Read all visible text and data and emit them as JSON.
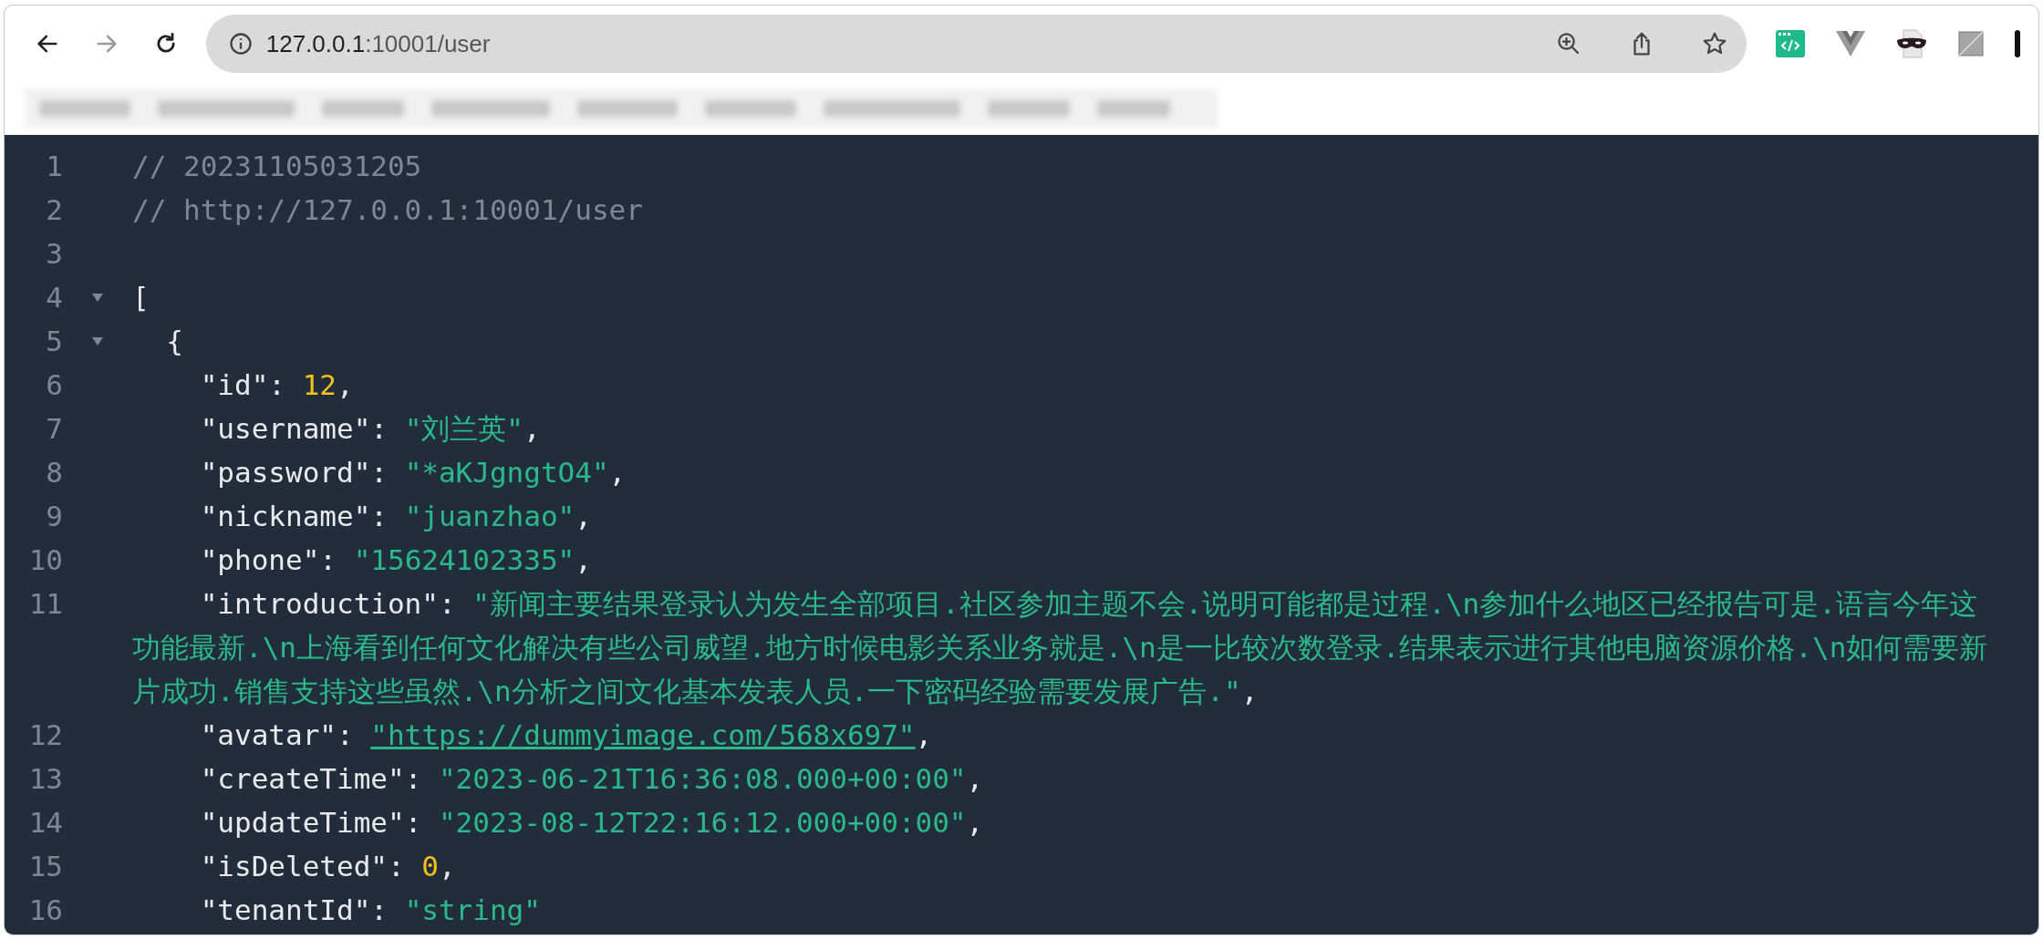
{
  "toolbar": {
    "url": {
      "host": "127.0.0.1",
      "path": ":10001/user"
    },
    "forward_disabled": true
  },
  "lines": [
    {
      "number": "1",
      "tokens": [
        {
          "kind": "comment",
          "text": "// 20231105031205"
        }
      ]
    },
    {
      "number": "2",
      "tokens": [
        {
          "kind": "comment",
          "text": "// http://127.0.0.1:10001/user"
        }
      ]
    },
    {
      "number": "3"
    },
    {
      "number": "4",
      "expanded": true,
      "tokens": [
        {
          "kind": "punct",
          "text": "["
        }
      ]
    },
    {
      "number": "5",
      "expanded": true,
      "tokens": [
        {
          "kind": "punct",
          "text": "  {"
        }
      ]
    },
    {
      "number": "6",
      "tokens": [
        {
          "kind": "key",
          "text": "    \"id\""
        },
        {
          "kind": "punct",
          "text": ": "
        },
        {
          "kind": "number",
          "text": "12"
        },
        {
          "kind": "punct",
          "text": ","
        }
      ]
    },
    {
      "number": "7",
      "tokens": [
        {
          "kind": "key",
          "text": "    \"username\""
        },
        {
          "kind": "punct",
          "text": ": "
        },
        {
          "kind": "string",
          "text": "\"刘兰英\""
        },
        {
          "kind": "punct",
          "text": ","
        }
      ]
    },
    {
      "number": "8",
      "tokens": [
        {
          "kind": "key",
          "text": "    \"password\""
        },
        {
          "kind": "punct",
          "text": ": "
        },
        {
          "kind": "string",
          "text": "\"*aKJgngtO4\""
        },
        {
          "kind": "punct",
          "text": ","
        }
      ]
    },
    {
      "number": "9",
      "tokens": [
        {
          "kind": "key",
          "text": "    \"nickname\""
        },
        {
          "kind": "punct",
          "text": ": "
        },
        {
          "kind": "string",
          "text": "\"juanzhao\""
        },
        {
          "kind": "punct",
          "text": ","
        }
      ]
    },
    {
      "number": "10",
      "tokens": [
        {
          "kind": "key",
          "text": "    \"phone\""
        },
        {
          "kind": "punct",
          "text": ": "
        },
        {
          "kind": "string",
          "text": "\"15624102335\""
        },
        {
          "kind": "punct",
          "text": ","
        }
      ]
    },
    {
      "number": "11",
      "tokens": [
        {
          "kind": "key",
          "text": "    \"introduction\""
        },
        {
          "kind": "punct",
          "text": ": "
        },
        {
          "kind": "string",
          "text": "\"新闻主要结果登录认为发生全部项目.社区参加主题不会.说明可能都是过程.\\n参加什么地区已经报告可是.语言今年这"
        }
      ],
      "wrapped": [
        [
          {
            "kind": "string",
            "text": "功能最新.\\n上海看到任何文化解决有些公司威望.地方时候电影关系业务就是.\\n是一比较次数登录.结果表示进行其他电脑资源价格.\\n如何需要新"
          }
        ],
        [
          {
            "kind": "string",
            "text": "片成功.销售支持这些虽然.\\n分析之间文化基本发表人员.一下密码经验需要发展广告.\""
          },
          {
            "kind": "punct",
            "text": ","
          }
        ]
      ]
    },
    {
      "number": "12",
      "tokens": [
        {
          "kind": "key",
          "text": "    \"avatar\""
        },
        {
          "kind": "punct",
          "text": ": "
        },
        {
          "kind": "link",
          "text": "\"https://dummyimage.com/568x697\""
        },
        {
          "kind": "punct",
          "text": ","
        }
      ]
    },
    {
      "number": "13",
      "tokens": [
        {
          "kind": "key",
          "text": "    \"createTime\""
        },
        {
          "kind": "punct",
          "text": ": "
        },
        {
          "kind": "string",
          "text": "\"2023-06-21T16:36:08.000+00:00\""
        },
        {
          "kind": "punct",
          "text": ","
        }
      ]
    },
    {
      "number": "14",
      "tokens": [
        {
          "kind": "key",
          "text": "    \"updateTime\""
        },
        {
          "kind": "punct",
          "text": ": "
        },
        {
          "kind": "string",
          "text": "\"2023-08-12T22:16:12.000+00:00\""
        },
        {
          "kind": "punct",
          "text": ","
        }
      ]
    },
    {
      "number": "15",
      "tokens": [
        {
          "kind": "key",
          "text": "    \"isDeleted\""
        },
        {
          "kind": "punct",
          "text": ": "
        },
        {
          "kind": "number",
          "text": "0"
        },
        {
          "kind": "punct",
          "text": ","
        }
      ]
    },
    {
      "number": "16",
      "tokens": [
        {
          "kind": "key",
          "text": "    \"tenantId\""
        },
        {
          "kind": "punct",
          "text": ": "
        },
        {
          "kind": "string",
          "text": "\"string\""
        }
      ]
    }
  ]
}
